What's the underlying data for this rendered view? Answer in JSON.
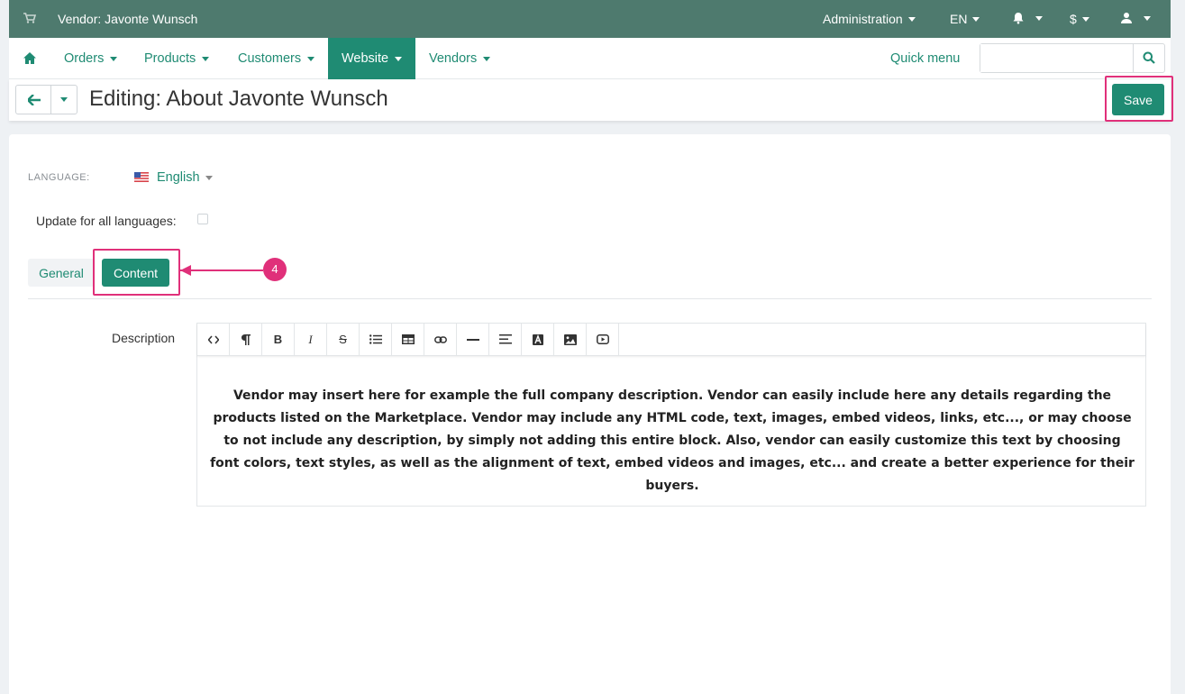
{
  "topbar": {
    "vendor_label": "Vendor: Javonte Wunsch",
    "administration": "Administration",
    "language": "EN",
    "currency": "$"
  },
  "nav": {
    "items": [
      "Orders",
      "Products",
      "Customers",
      "Website",
      "Vendors"
    ],
    "active": "Website",
    "quick_menu": "Quick menu",
    "search_placeholder": ""
  },
  "title": {
    "text": "Editing: About Javonte Wunsch",
    "save_label": "Save"
  },
  "form": {
    "language_label": "LANGUAGE:",
    "language_value": "English",
    "update_all_label": "Update for all languages:",
    "update_all_checked": false,
    "tabs": [
      "General",
      "Content"
    ],
    "active_tab": "Content",
    "callout_number": "4",
    "description_label": "Description",
    "description_text": "Vendor may insert here for example the full company description. Vendor can easily include here any details regarding the products listed on the Marketplace. Vendor may include any HTML code, text, images, embed videos, links, etc..., or may choose to not include any description, by simply not adding this entire block. Also, vendor can easily customize this text by choosing font colors, text styles, as well as the alignment of text, embed videos and images, etc... and create a better experience for their buyers."
  },
  "colors": {
    "topbar": "#4e7a6e",
    "accent": "#1f8b73",
    "highlight": "#e0307a"
  },
  "icons": [
    "cart-icon",
    "bell-icon",
    "user-icon",
    "home-icon",
    "search-icon",
    "back-arrow-icon",
    "flag-us-icon"
  ]
}
